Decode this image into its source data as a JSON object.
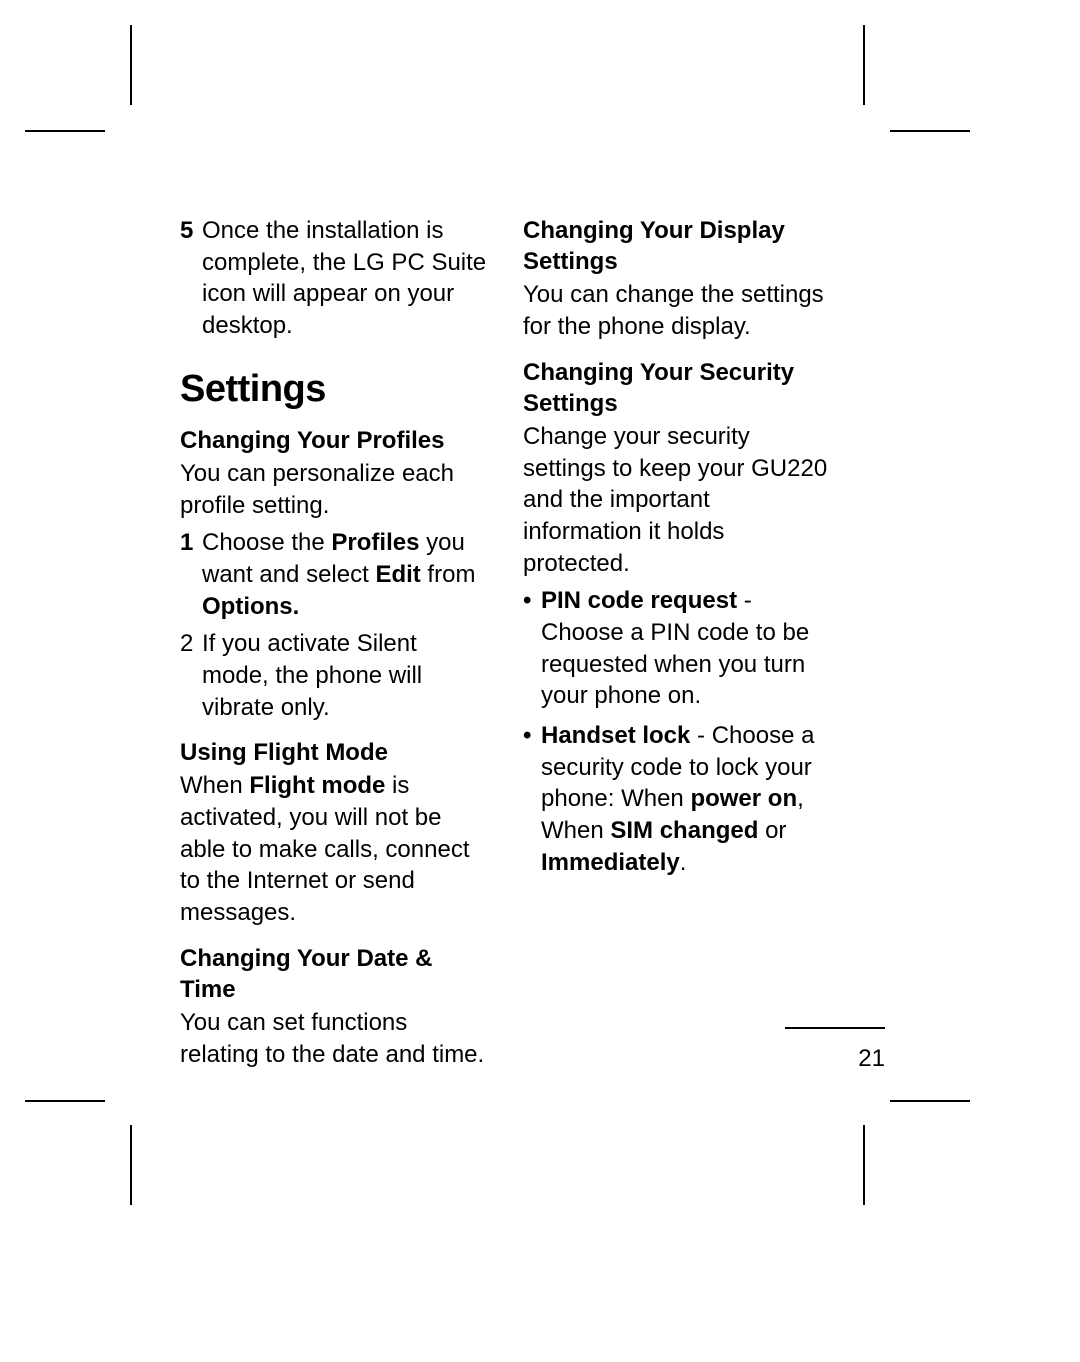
{
  "left": {
    "step5_num": "5",
    "step5_text_a": "Once the installation is complete, the LG PC Suite icon will appear on your desktop.",
    "section_heading": "Settings",
    "profiles_heading": "Changing Your Profiles",
    "profiles_body": "You can personalize each profile setting.",
    "step1_num": "1",
    "step1_pre": "Choose the ",
    "step1_b1": "Profiles",
    "step1_mid": " you want and select ",
    "step1_b2": "Edit",
    "step1_post": " from ",
    "step1_b3": "Options.",
    "step2_num": "2",
    "step2_text": "If you activate Silent mode, the phone will vibrate only.",
    "flight_heading": "Using Flight Mode",
    "flight_pre": "When ",
    "flight_b": "Flight mode",
    "flight_post": " is activated, you will not be able to make calls, connect to the Internet or send messages.",
    "datetime_heading": "Changing Your Date & Time",
    "datetime_body": "You can set functions relating to the date and time."
  },
  "right": {
    "display_heading": "Changing Your Display Settings",
    "display_body": "You can change the settings for the phone display.",
    "security_heading": "Changing Your Security Settings",
    "security_body": "Change your security settings to keep your GU220 and the important information it holds protected.",
    "bullet_dot": "•",
    "pin_b": "PIN code request",
    "pin_post": " - Choose a PIN code to be requested when you turn your phone on.",
    "hand_b": "Handset lock",
    "hand_mid1": " - Choose a security code to lock your phone: When ",
    "hand_b2": "power on",
    "hand_mid2": ", When ",
    "hand_b3": "SIM changed",
    "hand_mid3": " or ",
    "hand_b4": "Immediately",
    "hand_end": "."
  },
  "page_number": "21"
}
